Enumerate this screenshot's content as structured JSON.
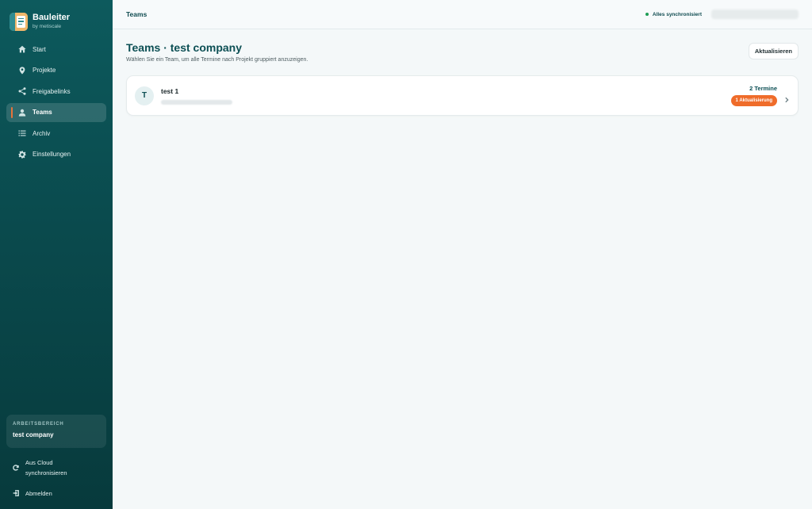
{
  "brand": {
    "title": "Bauleiter",
    "subtitle": "by metiscale"
  },
  "sidebar": {
    "items": [
      {
        "label": "Start",
        "icon": "home-icon",
        "active": false
      },
      {
        "label": "Projekte",
        "icon": "pin-icon",
        "active": false
      },
      {
        "label": "Freigabelinks",
        "icon": "share-icon",
        "active": false
      },
      {
        "label": "Teams",
        "icon": "user-icon",
        "active": true
      },
      {
        "label": "Archiv",
        "icon": "list-icon",
        "active": false
      },
      {
        "label": "Einstellungen",
        "icon": "gear-icon",
        "active": false
      }
    ],
    "workspace": {
      "label": "ARBEITSBEREICH",
      "name": "test company"
    },
    "sync_cloud": "Aus Cloud synchronisieren",
    "logout": "Abmelden"
  },
  "topbar": {
    "breadcrumb": "Teams",
    "sync_status": "Alles synchronisiert",
    "sync_color": "#1f9d55"
  },
  "main": {
    "title": "Teams · test company",
    "subtitle": "Wählen Sie ein Team, um alle Termine nach Projekt gruppiert anzuzeigen.",
    "refresh_label": "Aktualisieren",
    "teams": [
      {
        "initial": "T",
        "name": "test 1",
        "termine": "2 Termine",
        "badge": "1 Aktualisierung"
      }
    ]
  },
  "colors": {
    "accent": "#0c4f54",
    "badge": "#ef6c2a",
    "active_marker": "#e8743a"
  }
}
